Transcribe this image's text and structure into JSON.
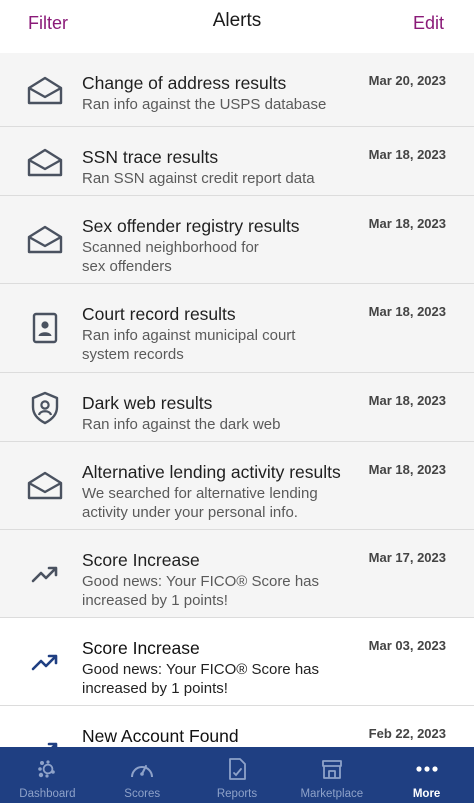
{
  "header": {
    "filter_label": "Filter",
    "title": "Alerts",
    "edit_label": "Edit"
  },
  "colors": {
    "accent": "#8a1a78",
    "tabbar": "#1f3f82",
    "read_row": "#f5f5f5",
    "icon_gray": "#4a5260",
    "icon_blue": "#1f3f82"
  },
  "alerts": [
    {
      "title": "Change of address results",
      "lines": [
        "Ran info against the USPS database"
      ],
      "date": "Mar 20, 2023",
      "icon": "envelope-icon"
    },
    {
      "title": "SSN trace results",
      "lines": [
        "Ran SSN against credit report data"
      ],
      "date": "Mar 18, 2023",
      "icon": "envelope-icon"
    },
    {
      "title": "Sex offender registry results",
      "lines": [
        "Scanned neighborhood for",
        "sex offenders"
      ],
      "date": "Mar 18, 2023",
      "icon": "envelope-icon"
    },
    {
      "title": "Court record results",
      "lines": [
        "Ran info against municipal court",
        "system records"
      ],
      "date": "Mar 18, 2023",
      "icon": "id-card-icon"
    },
    {
      "title": "Dark web results",
      "lines": [
        "Ran info against the dark web"
      ],
      "date": "Mar 18, 2023",
      "icon": "shield-user-icon"
    },
    {
      "title": "Alternative lending activity results",
      "lines": [
        "We searched for alternative lending",
        "activity under your personal info."
      ],
      "date": "Mar 18, 2023",
      "icon": "envelope-icon"
    },
    {
      "title": "Score Increase",
      "lines": [
        "Good news: Your FICO® Score has",
        "increased by 1 points!"
      ],
      "date": "Mar 17, 2023",
      "icon": "trend-up-icon"
    },
    {
      "title": "Score Increase",
      "lines": [
        "Good news: Your FICO® Score has",
        "increased by 1 points!"
      ],
      "date": "Mar 03, 2023",
      "icon": "trend-up-icon"
    },
    {
      "title": "New Account Found",
      "lines": [
        ""
      ],
      "date": "Feb 22, 2023",
      "icon": "trend-up-icon"
    }
  ],
  "tabs": [
    {
      "label": "Dashboard",
      "icon": "dashboard-icon"
    },
    {
      "label": "Scores",
      "icon": "gauge-icon"
    },
    {
      "label": "Reports",
      "icon": "report-icon"
    },
    {
      "label": "Marketplace",
      "icon": "storefront-icon"
    },
    {
      "label": "More",
      "icon": "more-dots-icon"
    }
  ]
}
